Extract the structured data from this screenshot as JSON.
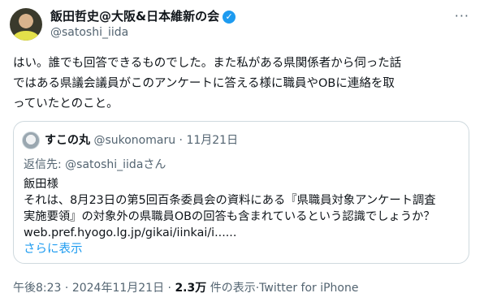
{
  "author": {
    "display_name": "飯田哲史@大阪&日本維新の会",
    "handle": "@satoshi_iida",
    "verified_glyph": "✓",
    "more_glyph": "···"
  },
  "tweet": {
    "text": "はい。誰でも回答できるものでした。また私がある県関係者から伺った話\nではある県議会議員がこのアンケートに答える様に職員やOBに連絡を取\nっていたとのこと。"
  },
  "quote": {
    "display_name": "すこの丸",
    "handle": "@sukonomaru",
    "separator": " · ",
    "date": "11月21日",
    "reply_prefix": "返信先: ",
    "reply_to": "@satoshi_iidaさん",
    "body": "飯田様\nそれは、8月23日の第5回百条委員会の資料にある『県職員対象アンケート調査\n実施要領』の対象外の県職員OBの回答も含まれているという認識でしょうか？\nweb.pref.hyogo.lg.jp/gikai/iinkai/i......",
    "show_more": "さらに表示"
  },
  "footer": {
    "time": "午後8:23",
    "separator": " · ",
    "date": "2024年11月21日",
    "separator2": " · ",
    "views_count": "2.3万",
    "views_suffix": " 件の表示·",
    "source": "Twitter for iPhone"
  },
  "colors": {
    "accent": "#1d9bf0",
    "secondary_text": "#536471",
    "border": "#cfd9de"
  }
}
